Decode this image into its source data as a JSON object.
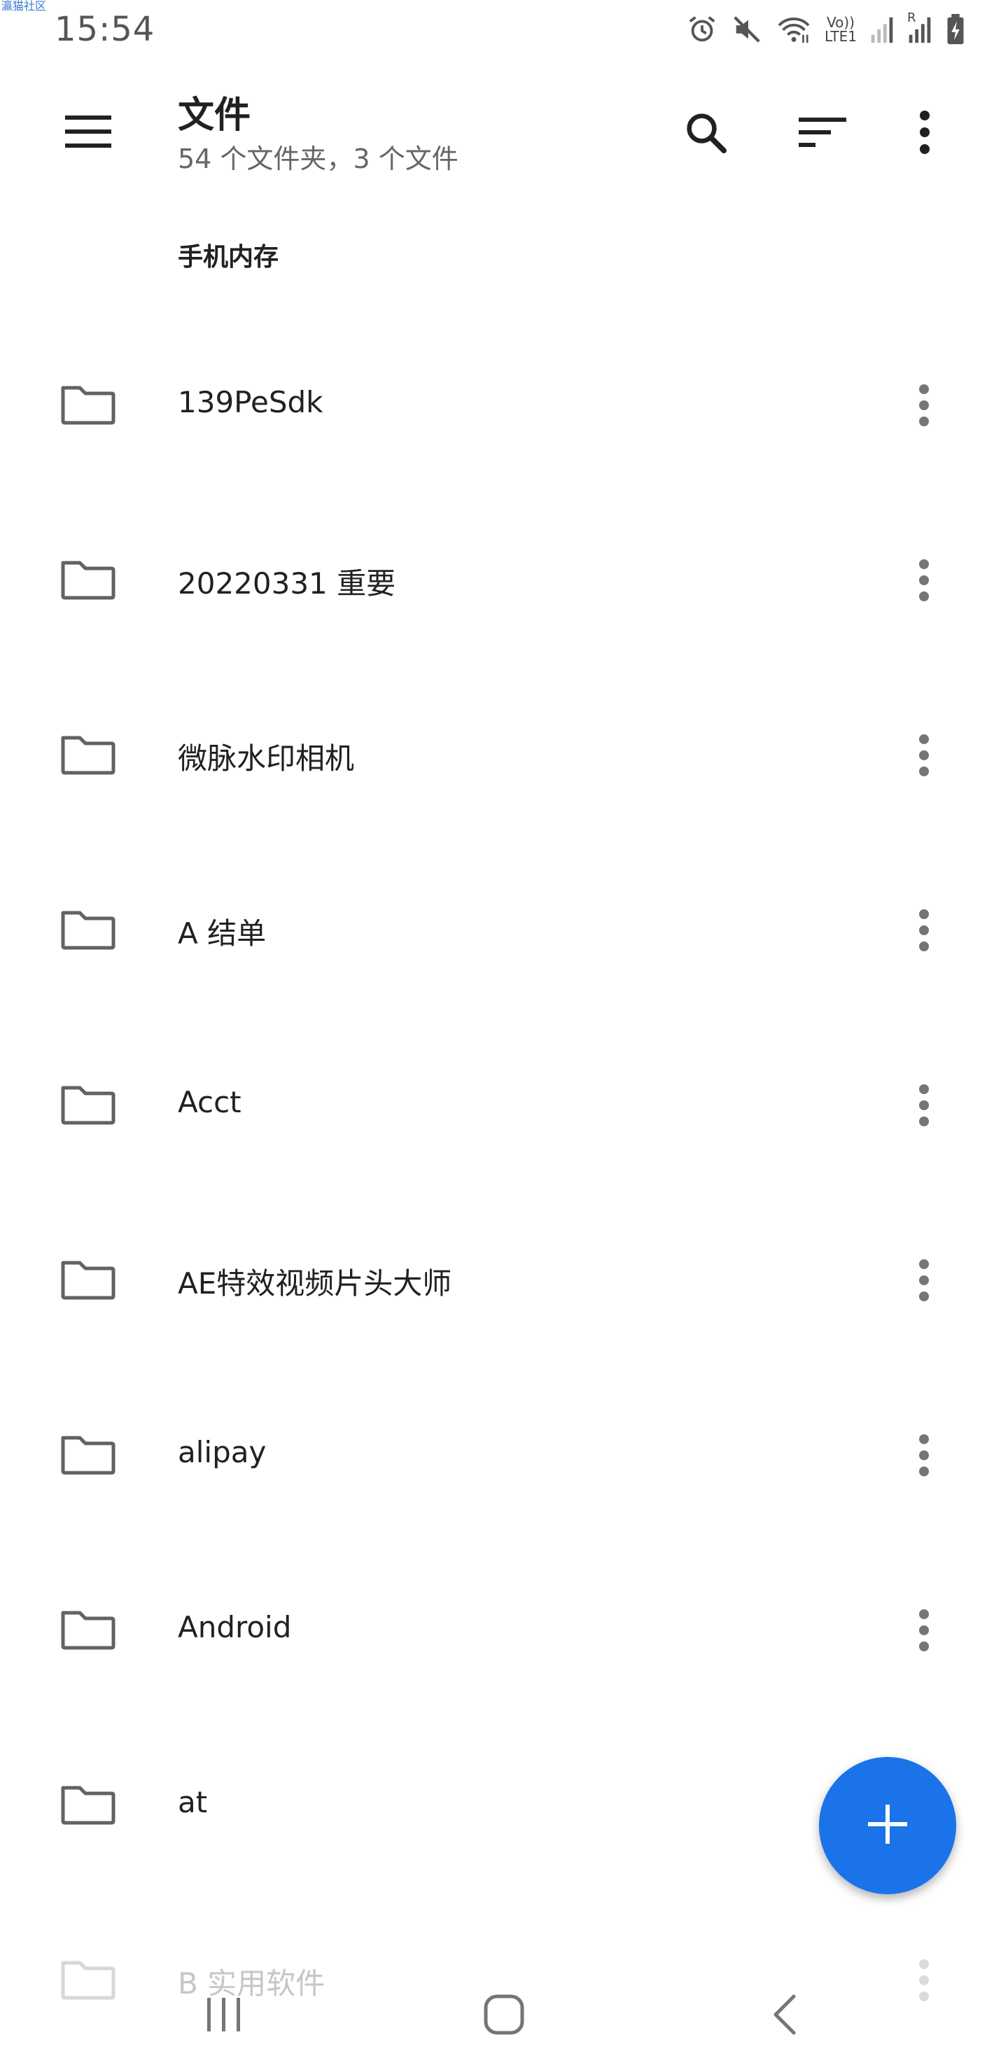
{
  "watermark": "瀛猫社区",
  "status_bar": {
    "time": "15:54",
    "volte_label": "Vo))",
    "lte_label": "LTE1",
    "roaming_label": "R",
    "icons": [
      "alarm-icon",
      "mute-icon",
      "wifi-icon",
      "volte-icon",
      "signal-icon",
      "signal-roaming-icon",
      "battery-charging-icon"
    ]
  },
  "app_bar": {
    "title": "文件",
    "subtitle": "54 个文件夹，3 个文件",
    "icons": [
      "menu-icon",
      "search-icon",
      "sort-icon",
      "more-vert-icon"
    ]
  },
  "section": {
    "header": "手机内存"
  },
  "folders": [
    {
      "name": "139PeSdk"
    },
    {
      "name": "20220331 重要"
    },
    {
      "name": "微脉水印相机"
    },
    {
      "name": "A 结单"
    },
    {
      "name": "Acct"
    },
    {
      "name": "AE特效视频片头大师"
    },
    {
      "name": "alipay"
    },
    {
      "name": "Android"
    },
    {
      "name": "at"
    },
    {
      "name": "B 实用软件"
    }
  ],
  "fab": {
    "icon": "plus-icon"
  },
  "colors": {
    "accent": "#1a73e8",
    "icon_gray": "#5f6368",
    "text": "#202124",
    "subtitle": "#666666"
  }
}
